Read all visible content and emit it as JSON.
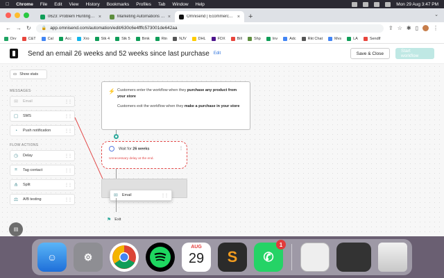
{
  "menubar": {
    "app": "Chrome",
    "items": [
      "File",
      "Edit",
      "View",
      "History",
      "Bookmarks",
      "Profiles",
      "Tab",
      "Window",
      "Help"
    ],
    "clock": "Mon 29 Aug  3:47 PM"
  },
  "tabs": [
    {
      "title": "0623: Problem Hunting - Goog",
      "color": "#0f9d58"
    },
    {
      "title": "Marketing Automations - Shop",
      "color": "#5e8e3e"
    },
    {
      "title": "Omnisend | Ecommerce Marke",
      "color": "#111111",
      "active": true
    }
  ],
  "url": "app.omnisend.com/automation/edit/630c6e4fffc573001de642aa",
  "bookmarks": [
    {
      "label": "Drv",
      "color": "#1fa463"
    },
    {
      "label": "C&T",
      "color": "#e8453c"
    },
    {
      "label": "Cal",
      "color": "#4285f4"
    },
    {
      "label": "Acc",
      "color": "#0f9d58"
    },
    {
      "label": "Xro",
      "color": "#13b5ea"
    },
    {
      "label": "Stk 4",
      "color": "#0f9d58"
    },
    {
      "label": "Stk 5",
      "color": "#0f9d58"
    },
    {
      "label": "Bmk",
      "color": "#0f9d58"
    },
    {
      "label": "Rtn",
      "color": "#0f9d58"
    },
    {
      "label": "NJV",
      "color": "#555555"
    },
    {
      "label": "DHL",
      "color": "#ffcc00"
    },
    {
      "label": "FDX",
      "color": "#4d148c"
    },
    {
      "label": "Bill",
      "color": "#e8453c"
    },
    {
      "label": "Shp",
      "color": "#5e8e3e"
    },
    {
      "label": "Inv",
      "color": "#0f9d58"
    },
    {
      "label": "Adc",
      "color": "#4285f4"
    },
    {
      "label": "Rkt Chat",
      "color": "#555555"
    },
    {
      "label": "Mvs",
      "color": "#4285f4"
    },
    {
      "label": "LA",
      "color": "#0f9d58"
    },
    {
      "label": "Sendlf",
      "color": "#e8453c"
    }
  ],
  "header": {
    "title": "Send an email 26 weeks and 52 weeks since last purchase",
    "edit": "Edit",
    "save_close": "Save & Close",
    "start": "Start workflow"
  },
  "sidebar": {
    "show_stats": "Show stats",
    "messages_title": "MESSAGES",
    "messages": [
      "Email",
      "SMS",
      "Push notification"
    ],
    "flow_title": "FLOW ACTIONS",
    "actions": [
      "Delay",
      "Tag contact",
      "Split",
      "A/B testing"
    ]
  },
  "trigger": {
    "line1_pre": "Customers enter the workflow when they ",
    "line1_bold": "purchase any product from your store",
    "line2_pre": "Customers exit the workflow when they ",
    "line2_bold": "make a purchase in your store"
  },
  "wait": {
    "pre": "Wait for ",
    "value": "26 weeks",
    "warning": "Unnecessary delay at the end."
  },
  "dragged": {
    "label": "Email"
  },
  "exit": {
    "label": "Exit"
  },
  "dock": {
    "calendar_month": "AUG",
    "calendar_day": "29",
    "whatsapp_badge": "1"
  }
}
